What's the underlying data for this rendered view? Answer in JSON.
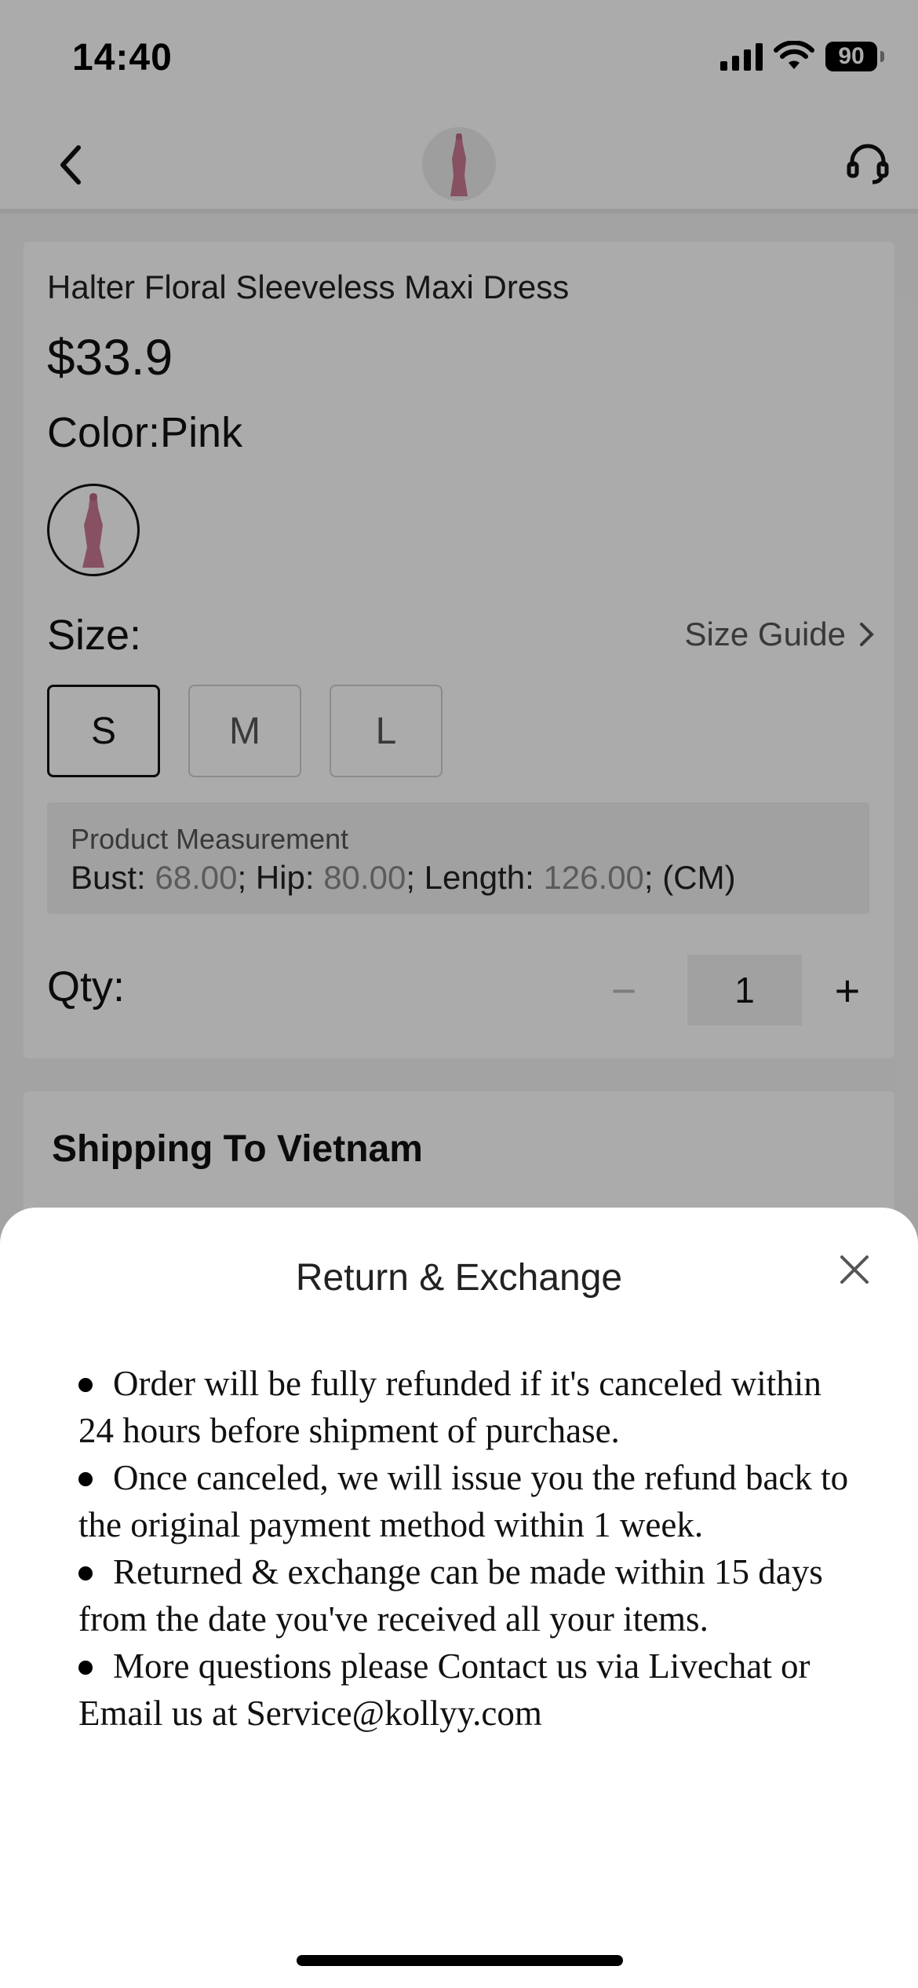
{
  "status_bar": {
    "time": "14:40",
    "battery": "90",
    "icons": [
      "signal-icon",
      "wifi-icon",
      "battery-icon"
    ]
  },
  "nav": {
    "back_icon": "chevron-left-icon",
    "support_icon": "headset-icon"
  },
  "product": {
    "title": "Halter Floral Sleeveless Maxi Dress",
    "price": "$33.9",
    "color_label": "Color:",
    "color_value": "Pink",
    "size_label": "Size:",
    "size_guide": "Size Guide",
    "sizes": [
      "S",
      "M",
      "L"
    ],
    "selected_size": "S",
    "measurement": {
      "title": "Product Measurement",
      "bust_label": "Bust: ",
      "bust": "68.00",
      "hip_label": "; Hip: ",
      "hip": "80.00",
      "length_label": "; Length: ",
      "length": "126.00",
      "unit": "; (CM)"
    },
    "qty_label": "Qty:",
    "qty_minus": "−",
    "qty": "1",
    "qty_plus": "+"
  },
  "shipping": {
    "title": "Shipping To Vietnam"
  },
  "sheet": {
    "title": "Return & Exchange",
    "items": [
      "Order will be fully refunded if it's canceled within 24 hours before shipment of purchase.",
      "Once canceled, we will issue you the refund back to the original payment method within 1 week.",
      "Returned & exchange can be made within 15 days from the date you've received all your items.",
      "More questions please Contact us via Livechat or Email us at Service@kollyy.com"
    ]
  },
  "colors": {
    "overlay": "#00000054",
    "dress_pink": "#c97a92",
    "text": "#111111"
  }
}
